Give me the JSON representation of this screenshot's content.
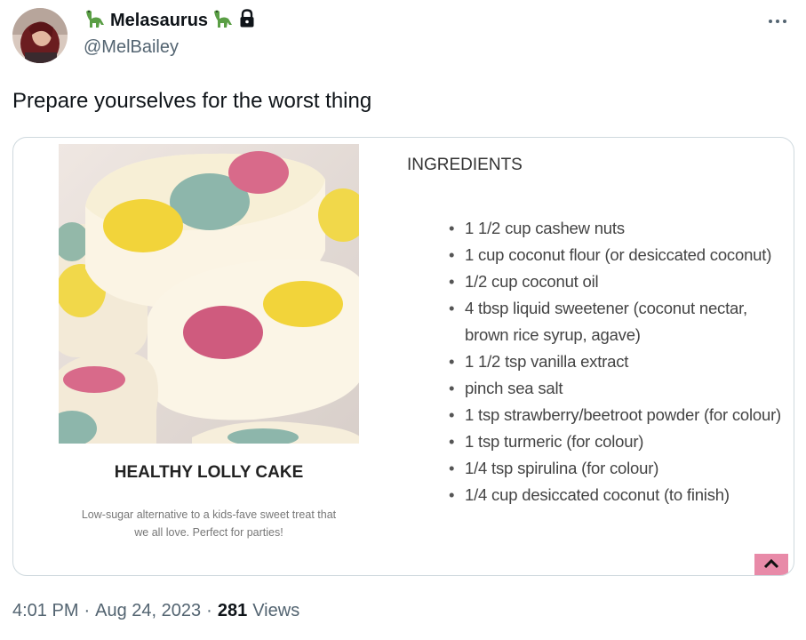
{
  "author": {
    "display_name": "Melasaurus",
    "handle": "@MelBailey",
    "prefix_icon": "dinosaur-emoji",
    "suffix_icon": "dinosaur-emoji",
    "protected_icon": "lock-icon"
  },
  "tweet": {
    "text": "Prepare yourselves for the worst thing"
  },
  "recipe": {
    "title": "HEALTHY LOLLY CAKE",
    "description": "Low-sugar alternative to a kids-fave sweet treat that we all love. Perfect for parties!",
    "ingredients_heading": "INGREDIENTS",
    "ingredients": [
      "1 1/2 cup cashew nuts",
      "1 cup coconut flour (or desiccated coconut)",
      "1/2 cup coconut oil",
      "4 tbsp liquid sweetener (coconut nectar, brown rice syrup, agave)",
      "1 1/2 tsp vanilla extract",
      "pinch sea salt",
      "1 tsp strawberry/beetroot powder (for colour)",
      "1 tsp turmeric (for colour)",
      "1/4 tsp spirulina (for colour)",
      "1/4 cup desiccated coconut (to finish)"
    ]
  },
  "meta": {
    "time": "4:01 PM",
    "separator1": "·",
    "date": "Aug 24, 2023",
    "separator2": "·",
    "views_count": "281",
    "views_label": "Views"
  },
  "colors": {
    "accent_scroll_button": "#e88aa8",
    "secondary_text": "#536471"
  }
}
